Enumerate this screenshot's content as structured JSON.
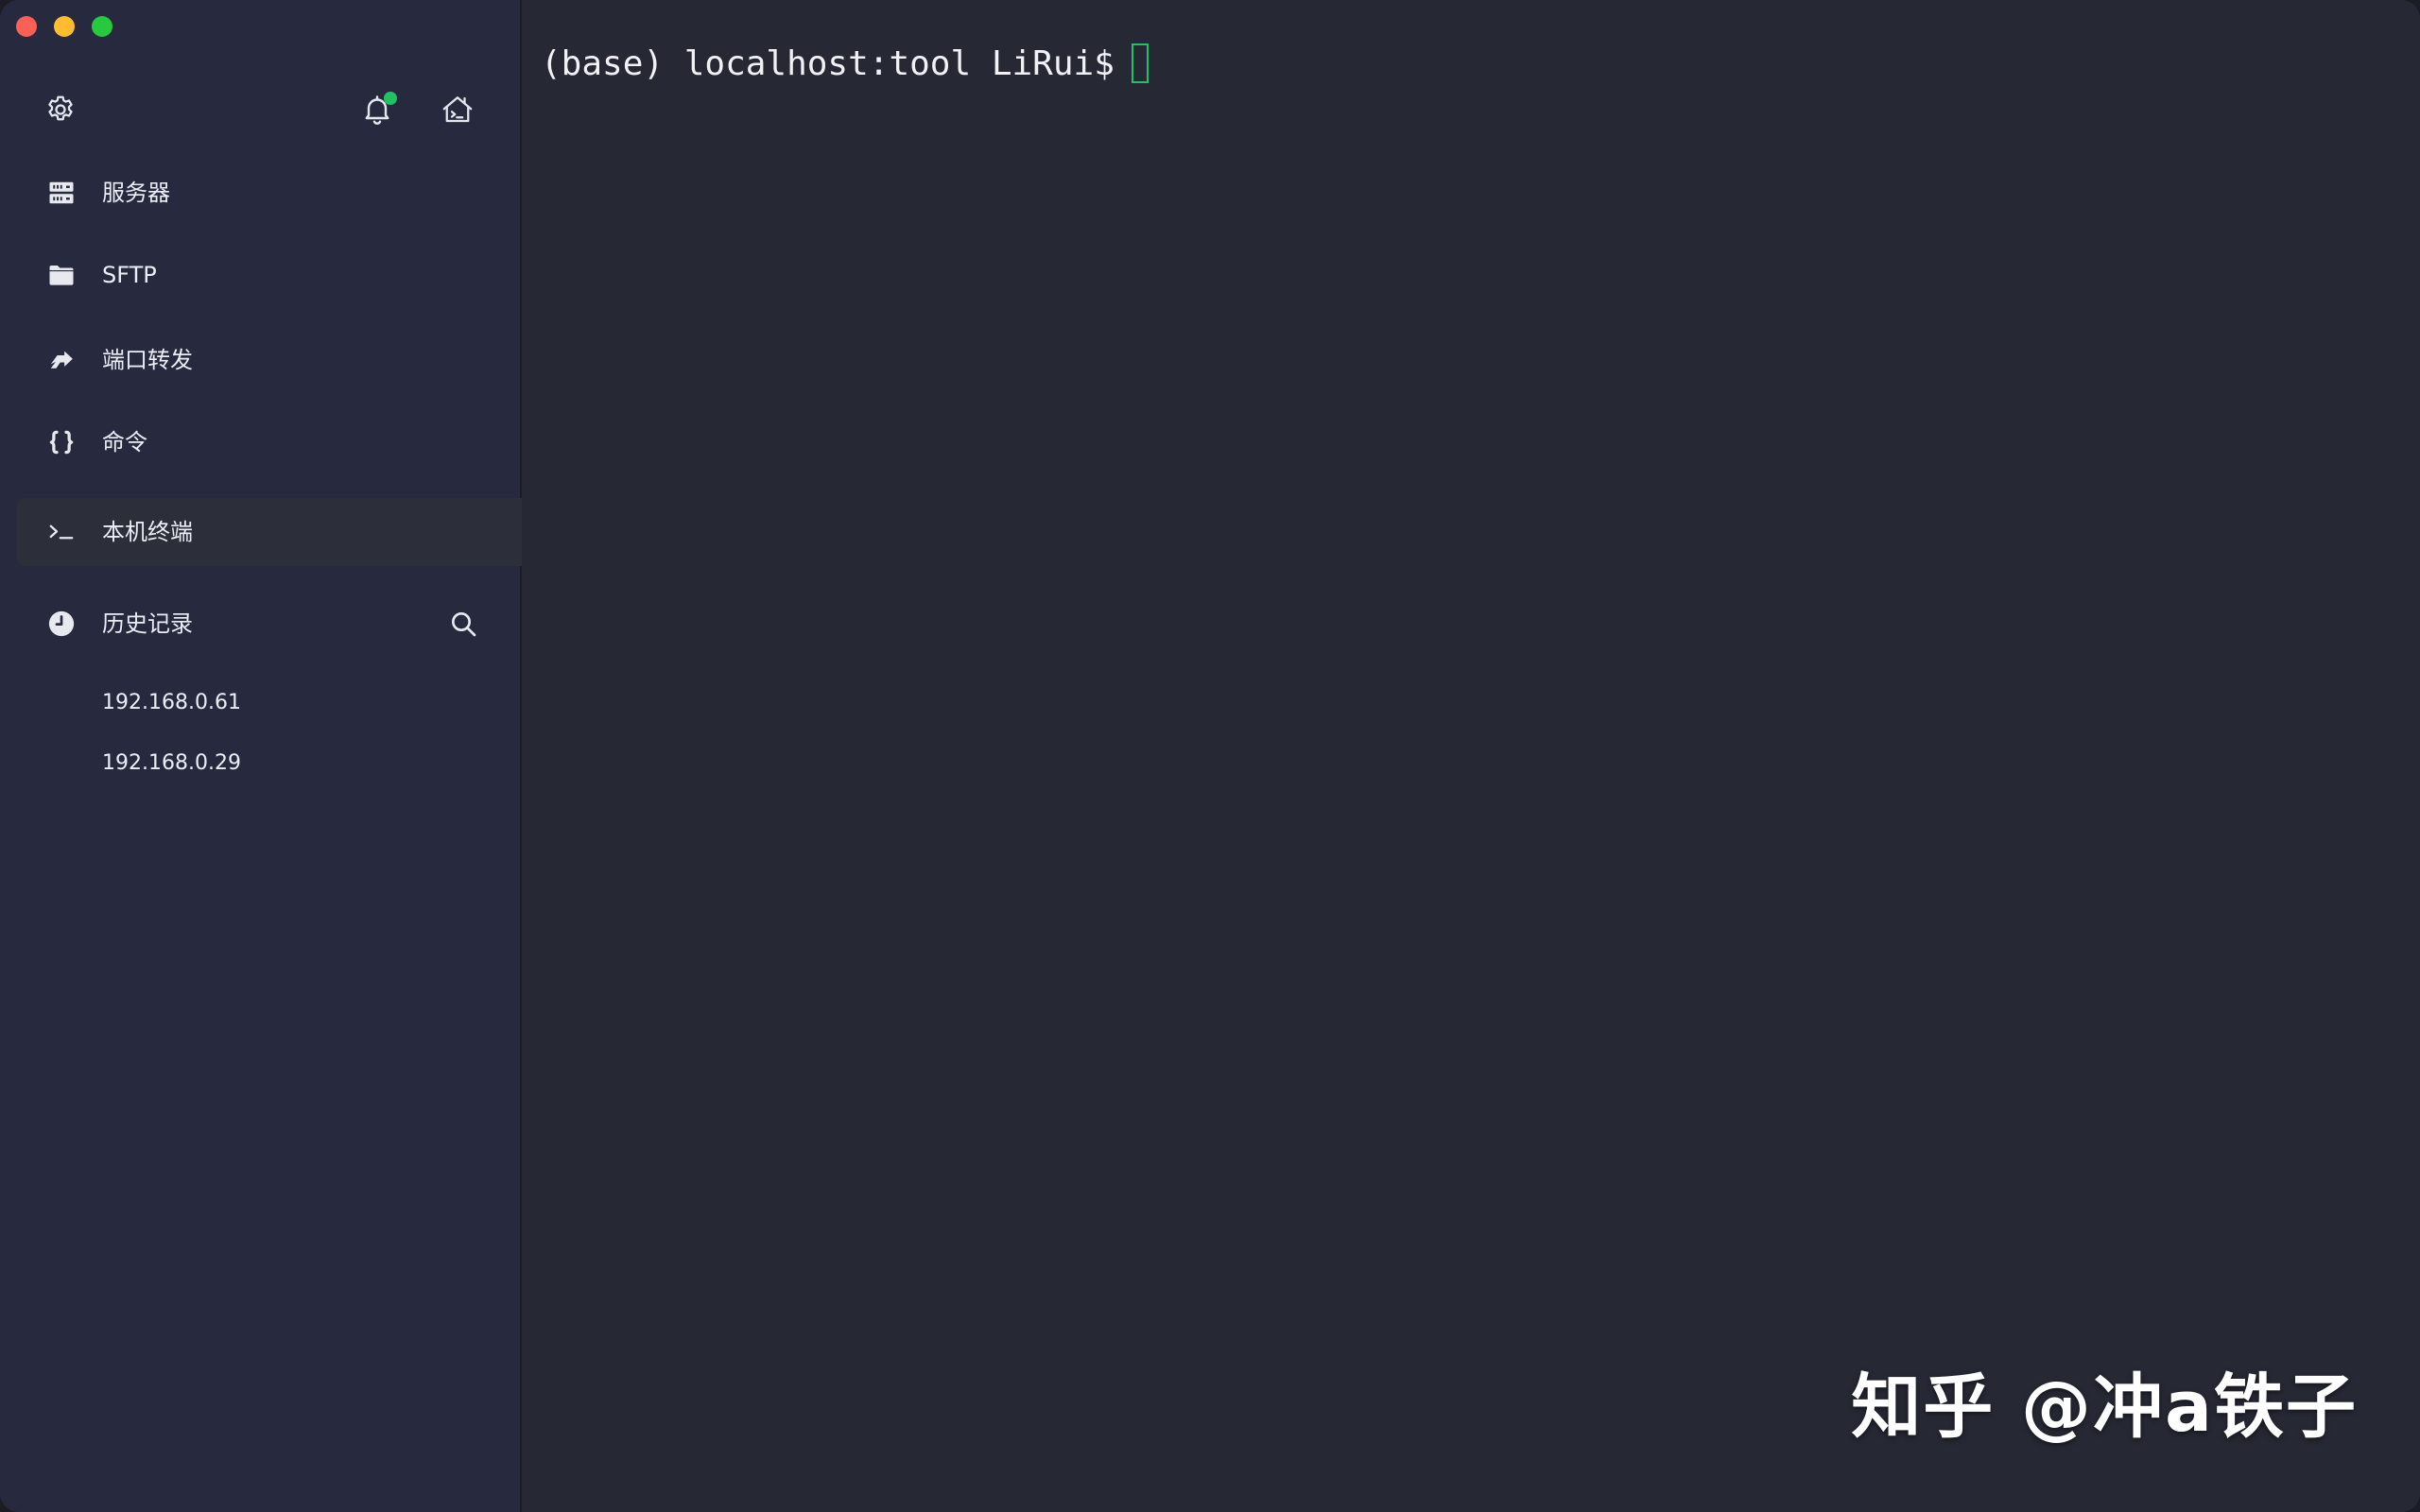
{
  "window": {
    "controls": [
      "close",
      "minimize",
      "zoom"
    ]
  },
  "sidebar": {
    "top_icons": [
      "gear-icon",
      "bell-icon",
      "home-terminal-icon"
    ],
    "notification_badge_color": "#21c263",
    "items": [
      {
        "label": "服务器",
        "icon": "server-icon"
      },
      {
        "label": "SFTP",
        "icon": "folder-icon"
      },
      {
        "label": "端口转发",
        "icon": "port-forward-icon"
      },
      {
        "label": "命令",
        "icon": "braces-icon"
      },
      {
        "label": "本机终端",
        "icon": "terminal-prompt-icon",
        "active": true
      }
    ],
    "history": {
      "label": "历史记录",
      "icon": "clock-icon",
      "search_icon": "search-icon",
      "entries": [
        "192.168.0.61",
        "192.168.0.29"
      ]
    }
  },
  "terminal": {
    "prompt": "(base) localhost:tool LiRui$",
    "cursor_color": "#21c263"
  },
  "watermark": {
    "text": "知乎 @冲a铁子"
  },
  "colors": {
    "sidebar_bg": "#272a3f",
    "terminal_bg": "#262834",
    "active_item_bg": "#2c2f3a",
    "accent": "#21c263"
  }
}
